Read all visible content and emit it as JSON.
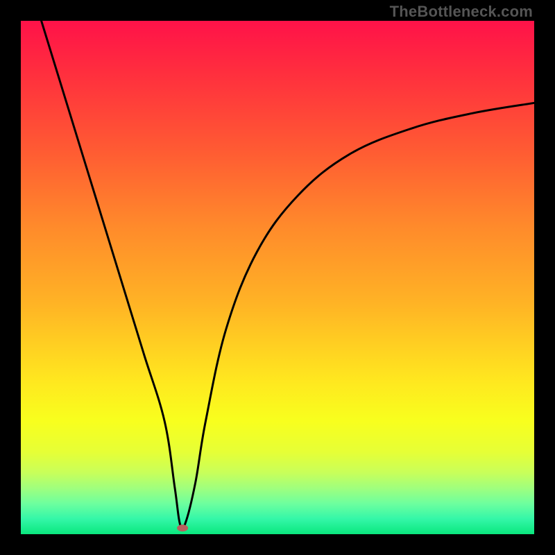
{
  "watermark": "TheBottleneck.com",
  "chart_data": {
    "type": "line",
    "title": "",
    "xlabel": "",
    "ylabel": "",
    "xlim": [
      0,
      100
    ],
    "ylim": [
      0,
      100
    ],
    "series": [
      {
        "name": "curve",
        "x": [
          4,
          8,
          12,
          16,
          20,
          24,
          28,
          30,
          31,
          32,
          34,
          36,
          40,
          46,
          54,
          64,
          76,
          88,
          100
        ],
        "values": [
          100,
          87,
          74,
          61,
          48,
          35,
          22,
          9,
          2,
          2,
          10,
          22,
          40,
          55,
          66,
          74,
          79,
          82,
          84
        ]
      }
    ],
    "marker": {
      "x": 31.5,
      "y": 1.2,
      "color": "#b8605e"
    },
    "background_gradient": {
      "top": "#ff1249",
      "mid": "#ffd321",
      "bottom": "#0ae77d"
    }
  }
}
